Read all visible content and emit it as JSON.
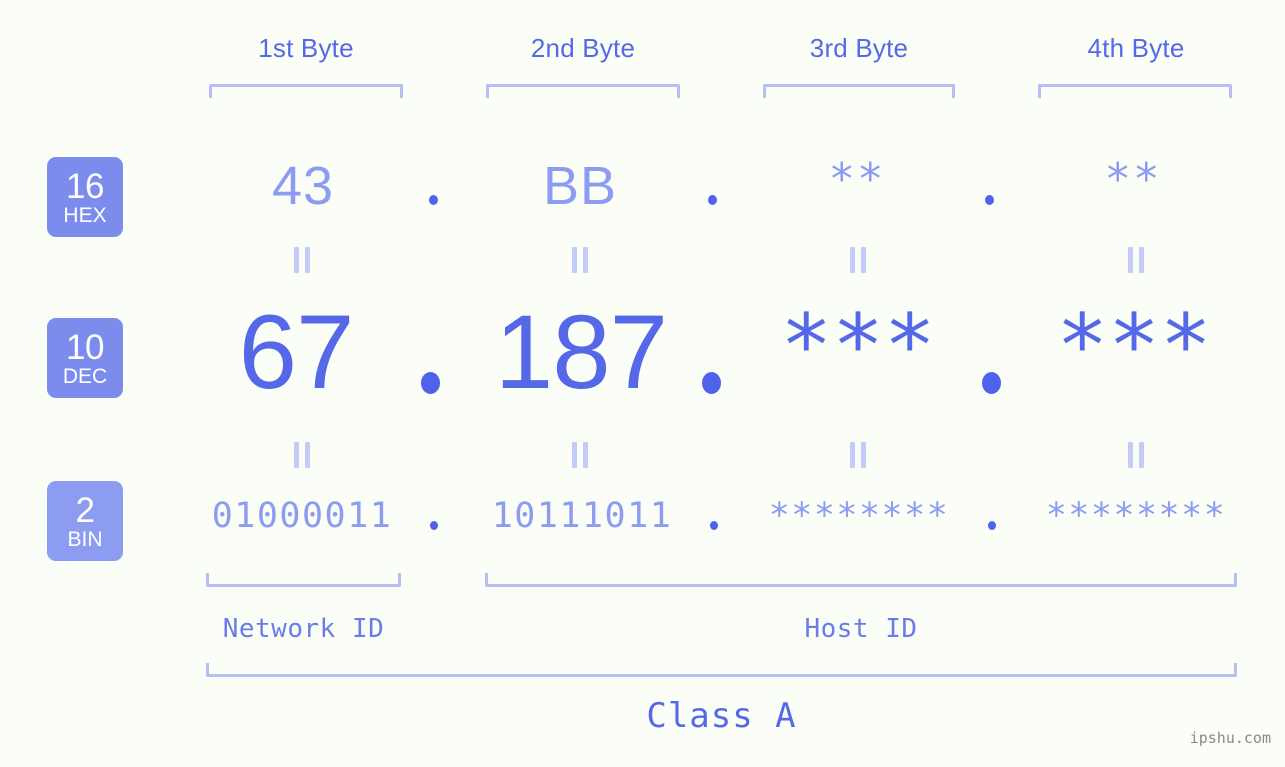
{
  "meta": {
    "watermark": "ipshu.com",
    "accent_strong": "#5569e8",
    "accent_light": "#8c9cf0",
    "bracket_color": "#b6c0f7",
    "badge_color": "#7b8cec",
    "background": "#fbfdf7"
  },
  "header": {
    "bytes": [
      {
        "label": "1st Byte"
      },
      {
        "label": "2nd Byte"
      },
      {
        "label": "3rd Byte"
      },
      {
        "label": "4th Byte"
      }
    ]
  },
  "rows": {
    "hex": {
      "badge_number": "16",
      "badge_name": "HEX",
      "values": [
        "43",
        "BB",
        "**",
        "**"
      ],
      "separator": "."
    },
    "dec": {
      "badge_number": "10",
      "badge_name": "DEC",
      "values": [
        "67",
        "187",
        "***",
        "***"
      ],
      "separator": "."
    },
    "bin": {
      "badge_number": "2",
      "badge_name": "BIN",
      "values": [
        "01000011",
        "10111011",
        "********",
        "********"
      ],
      "separator": "."
    }
  },
  "equals_marks": {
    "hex_to_dec": [
      "=",
      "=",
      "=",
      "="
    ],
    "dec_to_bin": [
      "=",
      "=",
      "=",
      "="
    ]
  },
  "footer": {
    "network_id_label": "Network ID",
    "host_id_label": "Host ID",
    "class_label": "Class A"
  }
}
